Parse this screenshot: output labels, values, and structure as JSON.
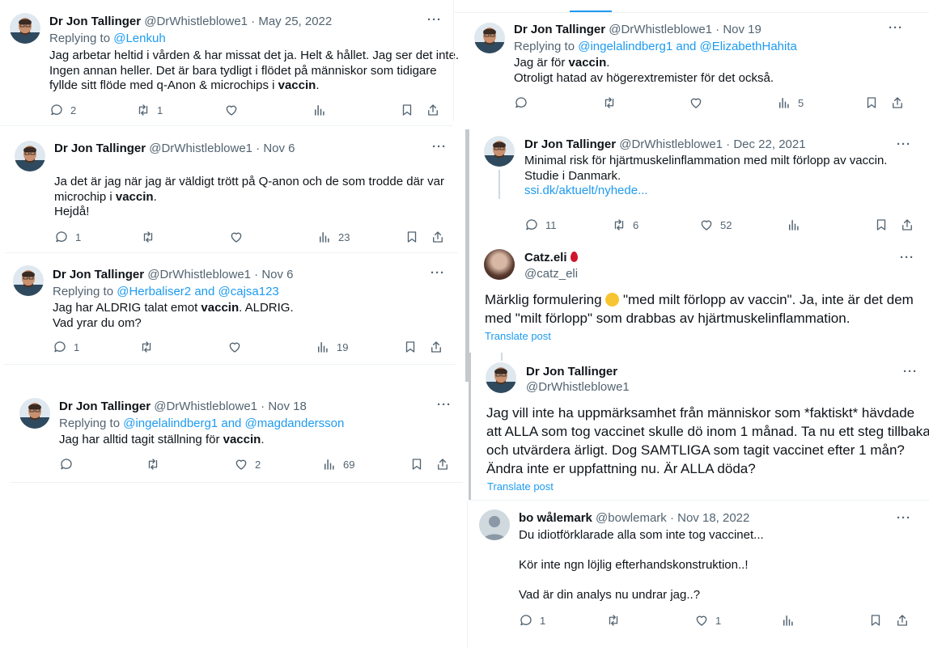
{
  "actions_icons": [
    "reply-icon",
    "retweet-icon",
    "like-icon",
    "views-icon",
    "bookmark-icon",
    "share-icon"
  ],
  "colors": {
    "link": "#1d9bf0",
    "muted": "#536471",
    "text": "#0f1419",
    "divider": "#eff3f4"
  },
  "left": {
    "t1": {
      "name": "Dr Jon Tallinger",
      "meta": "@DrWhistleblowe1 · May 25, 2022",
      "replying_prefix": "Replying to ",
      "replying": "@Lenkuh",
      "line1": "Jag arbetar heltid i vården & har missat det ja. Helt & hållet. Jag ser det inte.",
      "line2": "Ingen annan heller. Det är bara tydligt i flödet på människor som tidigare",
      "line3_pre": "fyllde sitt flöde med q-Anon & microchips i ",
      "line3_bold": "vaccin",
      "line3_post": ".",
      "replies": "2",
      "retweets": "1",
      "likes": "",
      "views": ""
    },
    "t2": {
      "name": "Dr Jon Tallinger",
      "meta": "@DrWhistleblowe1 · Nov 6",
      "line1": "Ja det är jag när jag är väldigt trött på Q-anon och de som trodde där var",
      "line2_pre": "microchip i ",
      "line2_bold": "vaccin",
      "line2_post": ".",
      "line3": "Hejdå!",
      "replies": "1",
      "retweets": "",
      "likes": "",
      "views": "23"
    },
    "t3": {
      "name": "Dr Jon Tallinger",
      "meta": "@DrWhistleblowe1 · Nov 6",
      "replying_prefix": "Replying to ",
      "replying": "@Herbaliser2 and @cajsa123",
      "line1_pre": "Jag har ALDRIG talat emot ",
      "line1_bold": "vaccin",
      "line1_post": ". ALDRIG.",
      "line2": "Vad yrar du om?",
      "replies": "1",
      "retweets": "",
      "likes": "",
      "views": "19"
    },
    "t4": {
      "name": "Dr Jon Tallinger",
      "meta": "@DrWhistleblowe1 · Nov 18",
      "replying_prefix": "Replying to ",
      "replying": "@ingelalindberg1 and @magdandersson",
      "line1_pre": "Jag har alltid tagit ställning för ",
      "line1_bold": "vaccin",
      "line1_post": ".",
      "replies": "",
      "retweets": "",
      "likes": "2",
      "views": "69"
    }
  },
  "right": {
    "t5": {
      "name": "Dr Jon Tallinger",
      "meta": "@DrWhistleblowe1 · Nov 19",
      "replying_prefix": "Replying to ",
      "replying": "@ingelalindberg1 and @ElizabethHahita",
      "line1_pre": "Jag är för ",
      "line1_bold": "vaccin",
      "line1_post": ".",
      "line2": "Otroligt hatad av högerextremister för det också.",
      "views": "5"
    },
    "t6": {
      "name": "Dr Jon Tallinger",
      "meta": "@DrWhistleblowe1 · Dec 22, 2021",
      "line1": "Minimal risk för hjärtmuskelinflammation med milt förlopp av vaccin.",
      "line2": "Studie i Danmark.",
      "link": "ssi.dk/aktuelt/nyhede...",
      "replies": "11",
      "retweets": "6",
      "likes": "52"
    },
    "t7": {
      "name": "Catz.eli",
      "handle": "@catz_eli",
      "line1_pre": "Märklig formulering ",
      "line1_post": " \"med milt förlopp av vaccin\". Ja, inte är det dem",
      "line2": "med \"milt förlopp\" som drabbas av hjärtmuskelinflammation.",
      "translate": "Translate post"
    },
    "t8": {
      "name": "Dr Jon Tallinger",
      "handle": "@DrWhistleblowe1",
      "line1": "Jag vill inte ha uppmärksamhet från människor som *faktiskt* hävdade",
      "line2": "att ALLA som tog vaccinet skulle dö inom 1 månad. Ta nu ett steg tillbaka",
      "line3": "och utvärdera ärligt. Dog SAMTLIGA som tagit vaccinet efter 1 mån?",
      "line4": "Ändra inte er uppfattning nu. Är ALLA döda?",
      "translate": "Translate post"
    },
    "t9": {
      "name": "bo wålemark",
      "meta": "@bowlemark · Nov 18, 2022",
      "line1": "Du idiotförklarade alla som inte tog vaccinet...",
      "line2": "Kör inte ngn löjlig efterhandskonstruktion..!",
      "line3": "Vad är din analys nu undrar jag..?",
      "replies": "1",
      "likes": "1"
    }
  }
}
